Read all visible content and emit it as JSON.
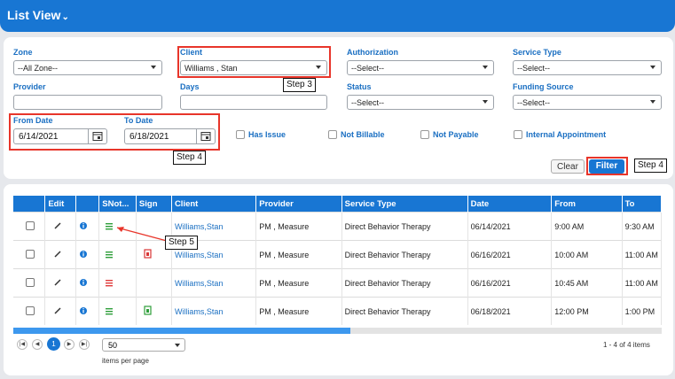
{
  "header": {
    "title": "List View"
  },
  "filters": {
    "zone": {
      "label": "Zone",
      "value": "--All Zone--"
    },
    "client": {
      "label": "Client",
      "value": "Williams , Stan"
    },
    "authorization": {
      "label": "Authorization",
      "value": "--Select--"
    },
    "service_type": {
      "label": "Service Type",
      "value": "--Select--"
    },
    "provider": {
      "label": "Provider",
      "value": ""
    },
    "days": {
      "label": "Days",
      "value": ""
    },
    "status": {
      "label": "Status",
      "value": "--Select--"
    },
    "funding_source": {
      "label": "Funding Source",
      "value": "--Select--"
    },
    "from_date": {
      "label": "From Date",
      "value": "6/14/2021"
    },
    "to_date": {
      "label": "To Date",
      "value": "6/18/2021"
    },
    "checkboxes": [
      "Has Issue",
      "Not Billable",
      "Not Payable",
      "Internal Appointment"
    ],
    "clear_label": "Clear",
    "filter_label": "Filter"
  },
  "annotations": {
    "step3": "Step 3",
    "step4a": "Step 4",
    "step4b": "Step 4",
    "step5": "Step 5"
  },
  "grid": {
    "columns": [
      "",
      "Edit",
      "",
      "SNot...",
      "Sign",
      "Client",
      "Provider",
      "Service Type",
      "Date",
      "From",
      "To"
    ],
    "rows": [
      {
        "client": "Williams,Stan",
        "provider": "PM , Measure",
        "service": "Direct Behavior Therapy",
        "date": "06/14/2021",
        "from": "9:00 AM",
        "to": "9:30 AM",
        "note_color": "#2e9e3a",
        "sign": ""
      },
      {
        "client": "Williams,Stan",
        "provider": "PM , Measure",
        "service": "Direct Behavior Therapy",
        "date": "06/16/2021",
        "from": "10:00 AM",
        "to": "11:00 AM",
        "note_color": "#2e9e3a",
        "sign": "red"
      },
      {
        "client": "Williams,Stan",
        "provider": "PM , Measure",
        "service": "Direct Behavior Therapy",
        "date": "06/16/2021",
        "from": "10:45 AM",
        "to": "11:00 AM",
        "note_color": "#e03a3a",
        "sign": ""
      },
      {
        "client": "Williams,Stan",
        "provider": "PM , Measure",
        "service": "Direct Behavior Therapy",
        "date": "06/18/2021",
        "from": "12:00 PM",
        "to": "1:00 PM",
        "note_color": "#2e9e3a",
        "sign": "green"
      }
    ]
  },
  "pager": {
    "current_page": "1",
    "page_size": "50",
    "items_per_page_label": "items per page",
    "count_text": "1 - 4 of 4 items",
    "scroll_fraction": 0.52
  }
}
